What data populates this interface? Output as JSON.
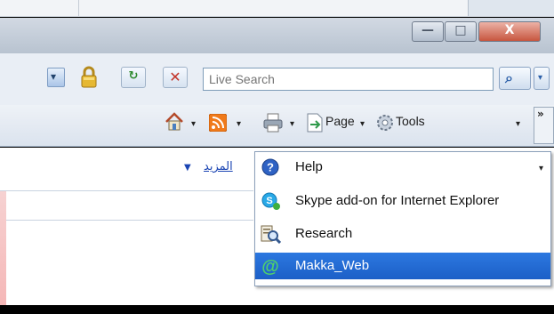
{
  "window": {
    "min_label": "—",
    "max_label": "□",
    "close_label": "X"
  },
  "address": {
    "dropdown_glyph": "▾",
    "refresh_glyph": "↻",
    "stop_glyph": "✕"
  },
  "search": {
    "placeholder": "Live Search",
    "button_glyph": "🔍",
    "dropdown_glyph": "▾"
  },
  "commands": {
    "page_label": "Page",
    "tools_label": "Tools",
    "more_glyph": "»",
    "tri": "▾"
  },
  "content": {
    "more_link": "المزيد",
    "more_arrow": "▼"
  },
  "menu": {
    "items": [
      {
        "label": "Help",
        "icon": "help-icon"
      },
      {
        "label": "Skype add-on for Internet Explorer",
        "icon": "skype-icon"
      },
      {
        "label": "Research",
        "icon": "research-icon"
      },
      {
        "label": "Makka_Web",
        "icon": "makka-web-icon"
      }
    ],
    "submenu_glyph": "▾"
  },
  "colors": {
    "highlight": "#1c5fc7",
    "link": "#1a44b3"
  }
}
